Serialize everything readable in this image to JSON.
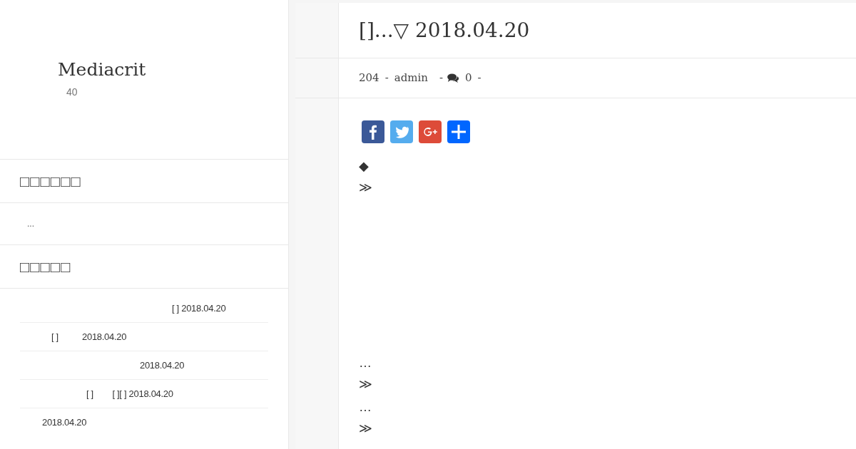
{
  "site": {
    "title": "Mediacrit",
    "subtitle": "40"
  },
  "widgets": [
    {
      "heading": "□□□□□□",
      "kind": "text",
      "text": "..."
    },
    {
      "heading": "□□□□□",
      "kind": "list",
      "items": [
        "[ ] 2018.04.20",
        "[ ]          2018.04.20",
        "2018.04.20",
        "[ ]        [ ][ ] 2018.04.20",
        "2018.04.20"
      ]
    }
  ],
  "post": {
    "title": "[]...▽ 2018.04.20",
    "meta": {
      "views": "204",
      "author": "admin",
      "comments": "0",
      "separator": "-"
    },
    "share": [
      {
        "kind": "facebook"
      },
      {
        "kind": "twitter"
      },
      {
        "kind": "google-plus"
      },
      {
        "kind": "more"
      }
    ],
    "body": [
      "◆",
      "≫",
      "…",
      "≫",
      "…",
      "≫"
    ]
  }
}
